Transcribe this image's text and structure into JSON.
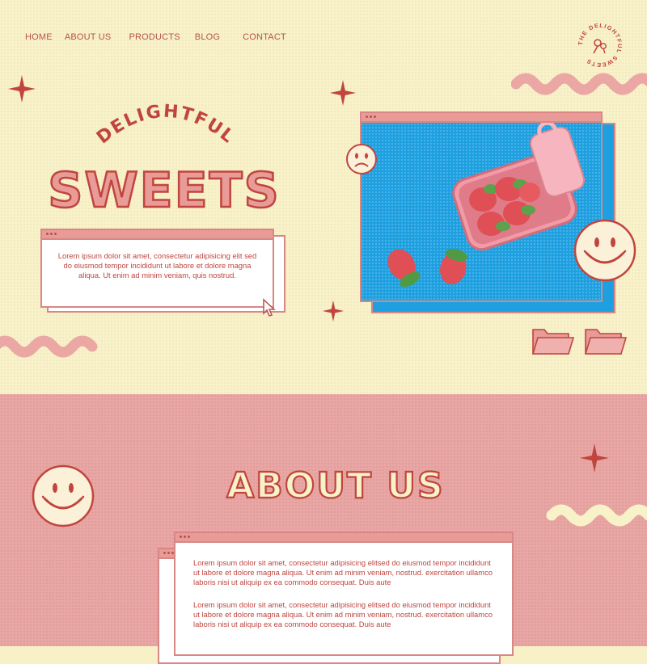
{
  "nav": {
    "items": [
      {
        "label": "HOME"
      },
      {
        "label": "ABOUT US"
      },
      {
        "label": "PRODUCTS"
      },
      {
        "label": "BLOG"
      },
      {
        "label": "CONTACT"
      }
    ]
  },
  "logo": {
    "text": "THE DELIGHTFUL SWEETS"
  },
  "hero": {
    "arc_title": "DELIGHTFUL",
    "title": "SWEETS",
    "card_text": "Lorem ipsum dolor sit amet, consectetur adipisicing elit sed do eiusmod tempor incididunt ut labore et dolore magna aliqua. Ut enim ad minim veniam, quis nostrud."
  },
  "about": {
    "title": "ABOUT US",
    "para1": "Lorem ipsum dolor sit amet, consectetur adipisicing elitsed do eiusmod tempor incididunt ut labore et dolore magna aliqua. Ut enim ad minim veniam, nostrud. exercitation ullamco laboris nisi ut aliquip ex ea commodo consequat. Duis aute",
    "para2": "Lorem ipsum dolor sit amet, consectetur adipisicing elitsed do eiusmod tempor incididunt ut labore et dolore magna aliqua. Ut enim ad minim veniam, nostrud. exercitation ullamco laboris nisi ut aliquip ex ea commodo consequat. Duis aute"
  },
  "colors": {
    "cream": "#f8f2c9",
    "pink": "#e8a6a4",
    "coral": "#c0453f",
    "blue": "#1ea0e0"
  },
  "icons": [
    "star-icon",
    "sad-face-icon",
    "smiley-face-icon",
    "folder-icon",
    "cursor-icon",
    "squiggle-decoration"
  ]
}
